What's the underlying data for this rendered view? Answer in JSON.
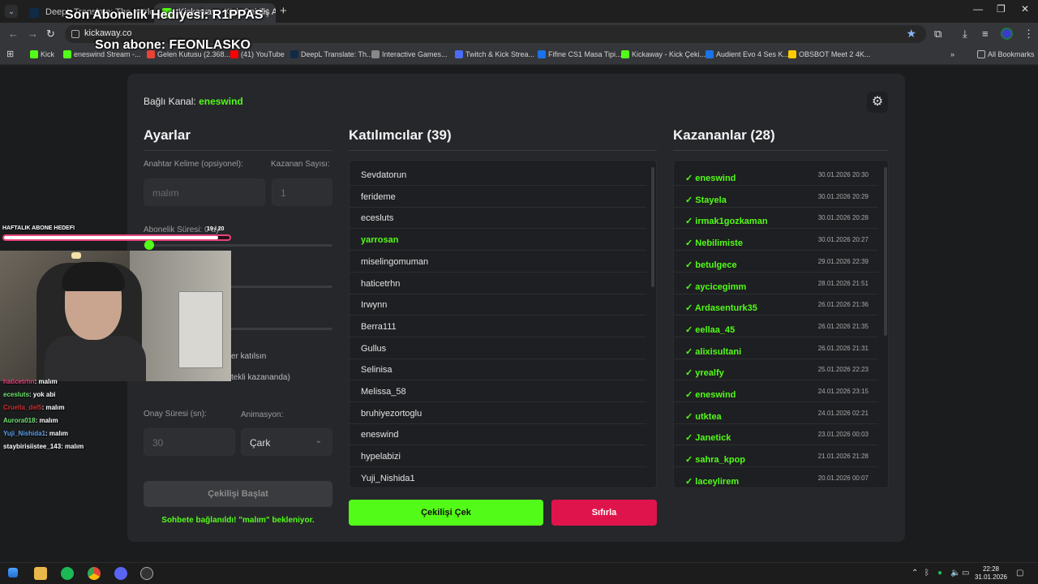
{
  "browser": {
    "tabs": [
      {
        "title": "DeepL Translate: The world's m"
      },
      {
        "title": "Kickaway - Kick Çekiliş Araç"
      }
    ],
    "url": "kickaway.co",
    "bookmarks": [
      {
        "label": "Kick",
        "color": "#53fc18"
      },
      {
        "label": "eneswind Stream -...",
        "color": "#53fc18"
      },
      {
        "label": "Gelen Kutusu (2.368...",
        "color": "#ea4335"
      },
      {
        "label": "(41) YouTube",
        "color": "#ff0000"
      },
      {
        "label": "DeepL Translate: Th...",
        "color": "#0f2b46"
      },
      {
        "label": "Interactive Games...",
        "color": "#888888"
      },
      {
        "label": "Twitch & Kick Strea...",
        "color": "#4a6cf7"
      },
      {
        "label": "Fifine CS1 Masa Tipi...",
        "color": "#1a73e8"
      },
      {
        "label": "Kickaway - Kick Çeki...",
        "color": "#53fc18"
      },
      {
        "label": "Audient Evo 4 Ses K...",
        "color": "#1a73e8"
      },
      {
        "label": "OBSBOT Meet 2 4K...",
        "color": "#ffcc00"
      }
    ],
    "all_bookmarks": "All Bookmarks"
  },
  "app": {
    "channel_label": "Bağlı Kanal:",
    "channel_name": "eneswind",
    "settings": {
      "title": "Ayarlar",
      "keyword_label": "Anahtar Kelime (opsiyonel):",
      "keyword_placeholder": "malım",
      "winners_count_label": "Kazanan Sayısı:",
      "winners_count_value": "1",
      "sub_duration_label": "Abonelik Süresi: 0 ay",
      "sub_only_partial": "er katılsın",
      "single_winner_partial": "tekli kazananda)",
      "confirm_label": "Onay Süresi (sn):",
      "confirm_value": "30",
      "animation_label": "Animasyon:",
      "animation_value": "Çark",
      "start_button": "Çekilişi Başlat",
      "status": "Sohbete bağlanıldı! \"malım\" bekleniyor."
    },
    "participants": {
      "title": "Katılımcılar (39)",
      "highlight_index": 3,
      "items": [
        "Sevdatorun",
        "ferideme",
        "ecesluts",
        "yarrosan",
        "miselingomuman",
        "haticetrhn",
        "Irwynn",
        "Berra111",
        "Gullus",
        "Selinisa",
        "Melissa_58",
        "bruhiyezortoglu",
        "eneswind",
        "hypelabizi",
        "Yuji_Nishida1"
      ]
    },
    "winners": {
      "title": "Kazananlar (28)",
      "items": [
        {
          "name": "eneswind",
          "date": "30.01.2026 20:30"
        },
        {
          "name": "Stayela",
          "date": "30.01.2026 20:29"
        },
        {
          "name": "irmak1gozkaman",
          "date": "30.01.2026 20:28"
        },
        {
          "name": "Nebilimiste",
          "date": "30.01.2026 20:27"
        },
        {
          "name": "betulgece",
          "date": "29.01.2026 22:39"
        },
        {
          "name": "aycicegimm",
          "date": "28.01.2026 21:51"
        },
        {
          "name": "Ardasenturk35",
          "date": "26.01.2026 21:36"
        },
        {
          "name": "eellaa_45",
          "date": "26.01.2026 21:35"
        },
        {
          "name": "alixisultani",
          "date": "26.01.2026 21:31"
        },
        {
          "name": "yrealfy",
          "date": "25.01.2026 22:23"
        },
        {
          "name": "eneswind",
          "date": "24.01.2026 23:15"
        },
        {
          "name": "utktea",
          "date": "24.01.2026 02:21"
        },
        {
          "name": "Janetick",
          "date": "23.01.2026 00:03"
        },
        {
          "name": "sahra_kpop",
          "date": "21.01.2026 21:28"
        },
        {
          "name": "laceylirem",
          "date": "20.01.2026 00:07"
        }
      ]
    },
    "draw_button": "Çekilişi Çek",
    "reset_button": "Sıfırla"
  },
  "overlay": {
    "last_gift": "Son Abonelik Hediyesi: R1PPAS",
    "last_sub": "Son abone: FEONLASKO",
    "goal_label": "HAFTALIK ABONE HEDEFI",
    "goal_count": "19 / 20",
    "goal_progress": 0.95,
    "chat": [
      {
        "user": "haticetrhn",
        "msg": ": malım",
        "color": "#e8457c"
      },
      {
        "user": "ecesluts",
        "msg": ": yok abi",
        "color": "#6ee46e"
      },
      {
        "user": "Cruella_del5",
        "msg": ": malım",
        "color": "#d03030"
      },
      {
        "user": "Aurora018",
        "msg": ": malım",
        "color": "#6ee46e"
      },
      {
        "user": "Yuji_Nishida1",
        "msg": ": malım",
        "color": "#5aa0f0"
      },
      {
        "user": "staybirisiistee_143",
        "msg": ": malım",
        "color": "#ffffff"
      }
    ]
  },
  "taskbar": {
    "time": "22:28",
    "date": "31.01.2026"
  }
}
